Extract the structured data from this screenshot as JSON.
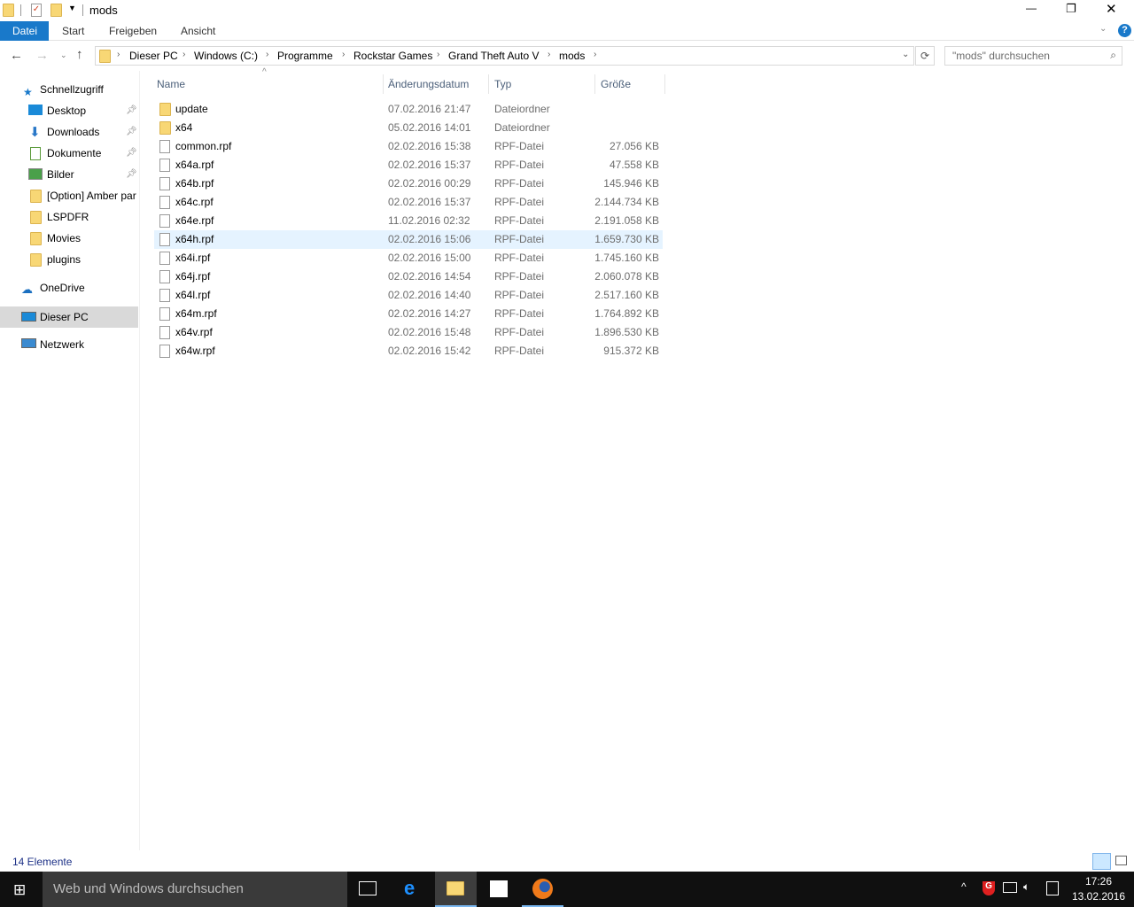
{
  "window": {
    "title": "mods",
    "minimize": "—",
    "maximize": "❐",
    "close": "✕"
  },
  "ribbon": {
    "tabs": [
      "Datei",
      "Start",
      "Freigeben",
      "Ansicht"
    ],
    "help": "?"
  },
  "address": {
    "crumbs": [
      "Dieser PC",
      "Windows (C:)",
      "Programme",
      "Rockstar Games",
      "Grand Theft Auto V",
      "mods"
    ]
  },
  "search": {
    "placeholder": "\"mods\" durchsuchen"
  },
  "nav": {
    "quick_access": "Schnellzugriff",
    "items": [
      "Desktop",
      "Downloads",
      "Dokumente",
      "Bilder",
      "[Option] Amber par",
      "LSPDFR",
      "Movies",
      "plugins"
    ],
    "onedrive": "OneDrive",
    "this_pc": "Dieser PC",
    "network": "Netzwerk"
  },
  "columns": {
    "name": "Name",
    "date": "Änderungsdatum",
    "type": "Typ",
    "size": "Größe"
  },
  "files": [
    {
      "name": "update",
      "date": "07.02.2016 21:47",
      "type": "Dateiordner",
      "size": "",
      "folder": true
    },
    {
      "name": "x64",
      "date": "05.02.2016 14:01",
      "type": "Dateiordner",
      "size": "",
      "folder": true
    },
    {
      "name": "common.rpf",
      "date": "02.02.2016 15:38",
      "type": "RPF-Datei",
      "size": "27.056 KB"
    },
    {
      "name": "x64a.rpf",
      "date": "02.02.2016 15:37",
      "type": "RPF-Datei",
      "size": "47.558 KB"
    },
    {
      "name": "x64b.rpf",
      "date": "02.02.2016 00:29",
      "type": "RPF-Datei",
      "size": "145.946 KB"
    },
    {
      "name": "x64c.rpf",
      "date": "02.02.2016 15:37",
      "type": "RPF-Datei",
      "size": "2.144.734 KB"
    },
    {
      "name": "x64e.rpf",
      "date": "11.02.2016 02:32",
      "type": "RPF-Datei",
      "size": "2.191.058 KB"
    },
    {
      "name": "x64h.rpf",
      "date": "02.02.2016 15:06",
      "type": "RPF-Datei",
      "size": "1.659.730 KB",
      "hover": true
    },
    {
      "name": "x64i.rpf",
      "date": "02.02.2016 15:00",
      "type": "RPF-Datei",
      "size": "1.745.160 KB"
    },
    {
      "name": "x64j.rpf",
      "date": "02.02.2016 14:54",
      "type": "RPF-Datei",
      "size": "2.060.078 KB"
    },
    {
      "name": "x64l.rpf",
      "date": "02.02.2016 14:40",
      "type": "RPF-Datei",
      "size": "2.517.160 KB"
    },
    {
      "name": "x64m.rpf",
      "date": "02.02.2016 14:27",
      "type": "RPF-Datei",
      "size": "1.764.892 KB"
    },
    {
      "name": "x64v.rpf",
      "date": "02.02.2016 15:48",
      "type": "RPF-Datei",
      "size": "1.896.530 KB"
    },
    {
      "name": "x64w.rpf",
      "date": "02.02.2016 15:42",
      "type": "RPF-Datei",
      "size": "915.372 KB"
    }
  ],
  "status": {
    "count": "14 Elemente"
  },
  "taskbar": {
    "search": "Web und Windows durchsuchen",
    "time": "17:26",
    "date": "13.02.2016"
  }
}
